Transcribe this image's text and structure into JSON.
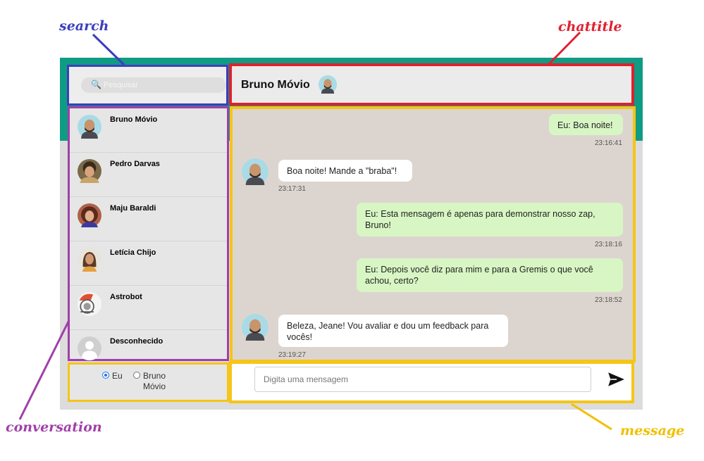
{
  "annotations": {
    "search": "search",
    "chattitle": "chattitle",
    "conversation": "conversation",
    "message": "message"
  },
  "colors": {
    "header_teal": "#0f9b84",
    "search_outline": "#3a3fbf",
    "chattitle_outline": "#e0202e",
    "conversation_outline": "#a040a8",
    "message_outline": "#f5c518",
    "my_bubble": "#d8f6c4",
    "their_bubble": "#ffffff",
    "chat_background": "#dcd5cf"
  },
  "search": {
    "placeholder": "Pesquisar",
    "icon": "search-icon"
  },
  "chat_title": {
    "name": "Bruno Móvio",
    "avatar": "bald-man-avatar"
  },
  "conversations": [
    {
      "name": "Bruno Móvio",
      "avatar": "bald-man-avatar"
    },
    {
      "name": "Pedro Darvas",
      "avatar": "curly-hair-avatar"
    },
    {
      "name": "Maju Baraldi",
      "avatar": "curly-woman-avatar"
    },
    {
      "name": "Letícia Chijo",
      "avatar": "woman-avatar"
    },
    {
      "name": "Astrobot",
      "avatar": "robot-avatar"
    },
    {
      "name": "Desconhecido",
      "avatar": "default-user-avatar"
    }
  ],
  "messages": [
    {
      "from": "me",
      "text": "Eu: Boa noite!",
      "time": "23:16:41"
    },
    {
      "from": "them",
      "text": "Boa noite! Mande a \"braba\"!",
      "time": "23:17:31"
    },
    {
      "from": "me",
      "text": "Eu: Esta mensagem é apenas para demonstrar nosso zap, Bruno!",
      "time": "23:18:16"
    },
    {
      "from": "me",
      "text": "Eu: Depois você diz para mim e para a Gremis o que você achou, certo?",
      "time": "23:18:52"
    },
    {
      "from": "them",
      "text": "Beleza, Jeane! Vou avaliar e dou um feedback para vocês!",
      "time": "23:19:27"
    }
  ],
  "sender": {
    "options": [
      {
        "label": "Eu",
        "selected": true
      },
      {
        "label": "Bruno Móvio",
        "selected": false
      }
    ]
  },
  "composer": {
    "placeholder": "Digita uma mensagem",
    "send_icon": "send-icon"
  }
}
